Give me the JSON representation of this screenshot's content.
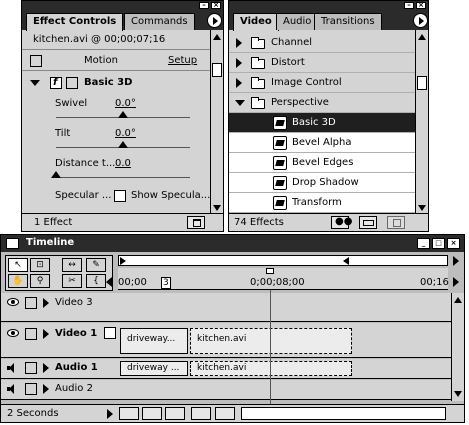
{
  "effect_controls": {
    "tabs": [
      "Effect Controls",
      "Commands"
    ],
    "clip_info": "kitchen.avi @ 00;00;07;16",
    "motion_label": "Motion",
    "setup_label": "Setup",
    "effect_name": "Basic 3D",
    "params": [
      {
        "label": "Swivel",
        "value": "0.0°",
        "level": 0.5
      },
      {
        "label": "Tilt",
        "value": "0.0°",
        "level": 0.5
      },
      {
        "label": "Distance t...",
        "value": "0.0",
        "level": 0.0
      }
    ],
    "specular_label": "Specular ...",
    "show_specular_label": "Show Specula...",
    "status": "1 Effect"
  },
  "effects_panel": {
    "tabs": [
      "Video",
      "Audio",
      "Transitions"
    ],
    "folders": [
      {
        "name": "Channel",
        "expanded": false
      },
      {
        "name": "Distort",
        "expanded": false
      },
      {
        "name": "Image Control",
        "expanded": false
      },
      {
        "name": "Perspective",
        "expanded": true
      }
    ],
    "effects": [
      "Basic 3D",
      "Bevel Alpha",
      "Bevel Edges",
      "Drop Shadow",
      "Transform"
    ],
    "selected_effect": "Basic 3D",
    "status": "74 Effects"
  },
  "timeline": {
    "title": "Timeline",
    "ruler": [
      "00;00",
      "0;00;08;00",
      "00;16"
    ],
    "tracks": [
      {
        "name": "Video 3",
        "kind": "video"
      },
      {
        "name": "Video 1",
        "kind": "video"
      },
      {
        "name": "Audio 1",
        "kind": "audio"
      },
      {
        "name": "Audio 2",
        "kind": "audio"
      }
    ],
    "clips": {
      "video1_a": "driveway...",
      "video1_b": "kitchen.avi",
      "audio1_a": "driveway ...",
      "audio1_b": "kitchen.avi"
    },
    "marker": "3",
    "zoom": "2 Seconds"
  }
}
